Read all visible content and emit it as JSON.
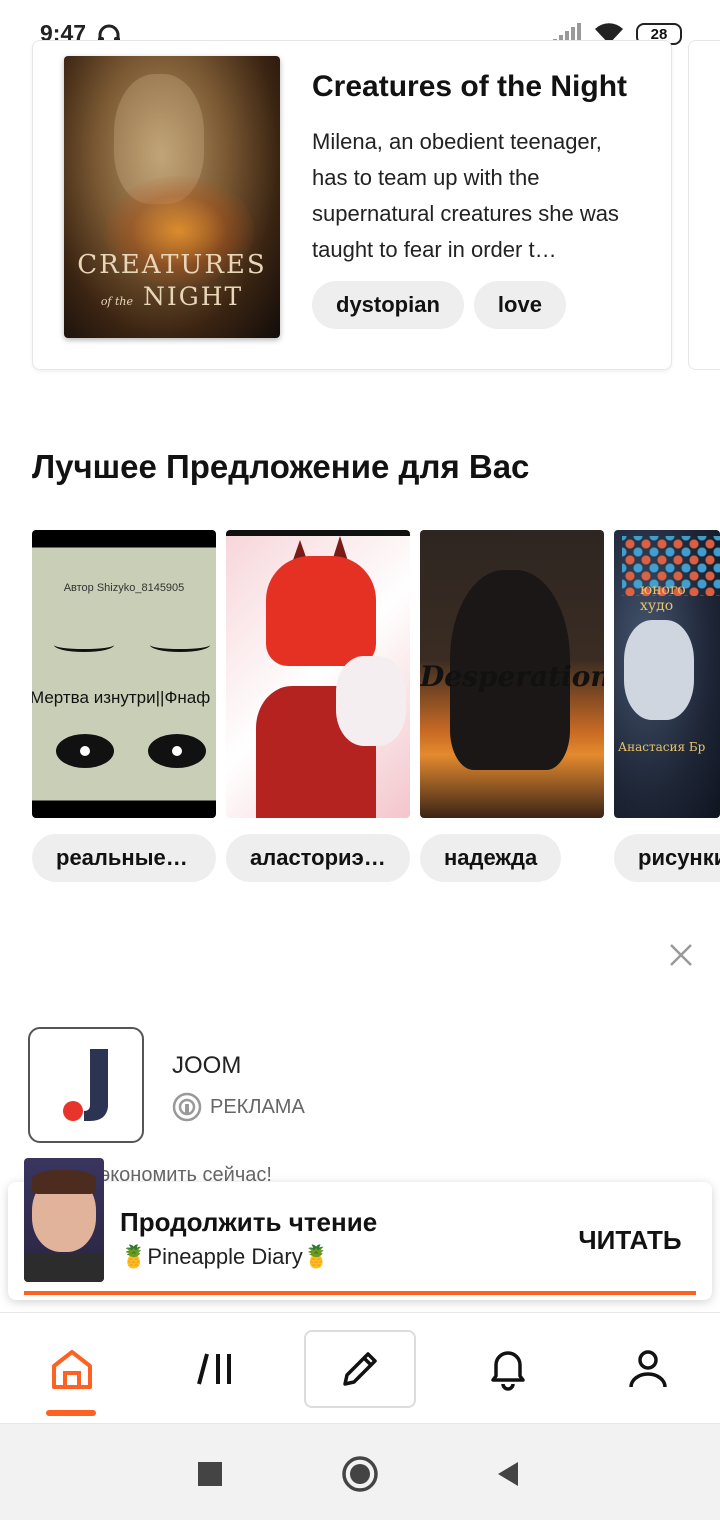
{
  "status_bar": {
    "time": "9:47",
    "battery": "28"
  },
  "book": {
    "title": "Creatures of the Night",
    "description": "Milena, an obedient teenager, has to team up with the supernatural creatures she was taught to fear in order t…",
    "tags": [
      "dystopian",
      "love"
    ],
    "cover_text_line1": "CREATURES",
    "cover_text_of_the": "of the",
    "cover_text_line2": "NIGHT"
  },
  "recommendations": {
    "title": "Лучшее Предложение для Вас",
    "items": [
      {
        "tag": "реальные…",
        "cover_author": "Автор Shizyko_8145905",
        "cover_title": "Мертва изнутри||Фнаф"
      },
      {
        "tag": "аласториэ…"
      },
      {
        "tag": "надежда",
        "cover_title": "Desperation"
      },
      {
        "tag": "рисунки",
        "cover_title": "юного худо",
        "cover_author": "Анастасия Бр"
      }
    ]
  },
  "ad": {
    "advertiser": "JOOM",
    "label": "РЕКЛАМА",
    "text": "экономить сейчас!"
  },
  "continue_reading": {
    "title": "Продолжить чтение",
    "story": "🍍Pineapple Diary🍍",
    "button": "ЧИТАТЬ",
    "progress": 1.0
  },
  "colors": {
    "accent": "#ff6122",
    "chip_bg": "#eeeeee"
  },
  "bottom_nav": {
    "items": [
      "home-icon",
      "library-icon",
      "write-icon",
      "notifications-icon",
      "profile-icon"
    ],
    "active": "home-icon"
  }
}
